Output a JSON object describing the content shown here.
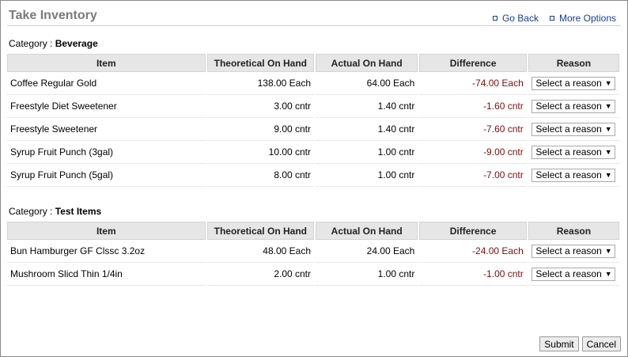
{
  "header": {
    "title": "Take Inventory",
    "go_back": "Go Back",
    "more_options": "More Options"
  },
  "columns": {
    "item": "Item",
    "theoretical": "Theoretical On Hand",
    "actual": "Actual On Hand",
    "difference": "Difference",
    "reason": "Reason"
  },
  "category_prefix": "Category : ",
  "reason_placeholder": "Select a reason",
  "categories": [
    {
      "name": "Beverage",
      "rows": [
        {
          "item": "Coffee Regular Gold",
          "theoretical": "138.00 Each",
          "actual": "64.00 Each",
          "difference": "-74.00 Each"
        },
        {
          "item": "Freestyle Diet Sweetener",
          "theoretical": "3.00 cntr",
          "actual": "1.40 cntr",
          "difference": "-1.60 cntr"
        },
        {
          "item": "Freestyle Sweetener",
          "theoretical": "9.00 cntr",
          "actual": "1.40 cntr",
          "difference": "-7.60 cntr"
        },
        {
          "item": "Syrup Fruit Punch (3gal)",
          "theoretical": "10.00 cntr",
          "actual": "1.00 cntr",
          "difference": "-9.00 cntr"
        },
        {
          "item": "Syrup Fruit Punch (5gal)",
          "theoretical": "8.00 cntr",
          "actual": "1.00 cntr",
          "difference": "-7.00 cntr"
        }
      ]
    },
    {
      "name": "Test Items",
      "rows": [
        {
          "item": "Bun Hamburger GF Clssc 3.2oz",
          "theoretical": "48.00 Each",
          "actual": "24.00 Each",
          "difference": "-24.00 Each"
        },
        {
          "item": "Mushroom Slicd Thin 1/4in",
          "theoretical": "2.00 cntr",
          "actual": "1.00 cntr",
          "difference": "-1.00 cntr"
        }
      ]
    }
  ],
  "footer": {
    "submit": "Submit",
    "cancel": "Cancel"
  },
  "colors": {
    "title": "#7a7a7a",
    "link": "#1a3d8a",
    "difference": "#7a0f0f",
    "header_bg": "#e6e6e6"
  },
  "icons": {
    "link_bullet": "square-bullet-icon",
    "select_caret": "caret-down-icon"
  }
}
